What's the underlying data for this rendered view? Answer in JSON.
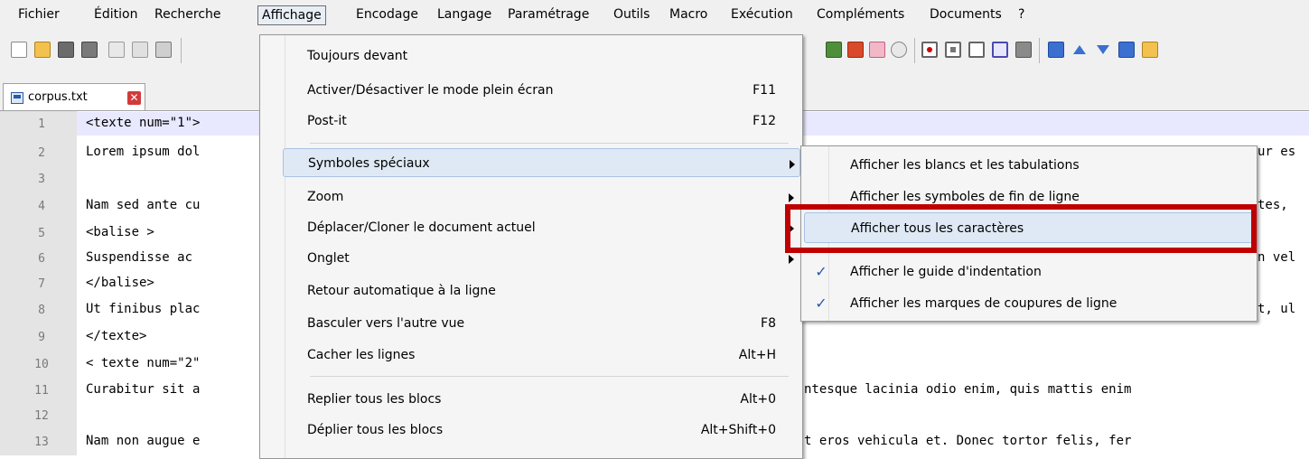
{
  "menubar": {
    "items": [
      "Fichier",
      "Édition",
      "Recherche",
      "Affichage",
      "Encodage",
      "Langage",
      "Paramétrage",
      "Outils",
      "Macro",
      "Exécution",
      "Compléments",
      "Documents",
      "?"
    ],
    "active_index": 3
  },
  "toolbar": {
    "left_icons": [
      "new-file-icon",
      "open-folder-icon",
      "save-icon",
      "save-all-icon",
      "close-icon",
      "close-all-icon",
      "print-icon"
    ],
    "right_icons": [
      "document-map-icon",
      "function-list-icon",
      "folder-workspace-icon",
      "monitoring-icon",
      "record-macro-icon",
      "stop-record-icon",
      "playback-macro-icon",
      "run-macro-multiple-icon",
      "save-macro-icon",
      "sort-icon",
      "arrow-up-icon",
      "arrow-down-icon",
      "sort-descending-icon",
      "folder-icon"
    ]
  },
  "tab": {
    "name": "corpus.txt",
    "close_glyph": "✕"
  },
  "editor": {
    "line_numbers": [
      "1",
      "2",
      "3",
      "4",
      "5",
      "6",
      "7",
      "8",
      "9",
      "10",
      "11",
      "12",
      "13"
    ],
    "lines_left": [
      "<texte num=\"1\">",
      "Lorem ipsum dol",
      "",
      "Nam sed ante cu",
      "<balise >",
      "Suspendisse ac",
      "</balise>",
      "Ut finibus plac",
      "</texte>",
      "< texte num=\"2\"",
      "Curabitur sit a",
      "",
      "Nam non augue e"
    ],
    "lines_right": [
      "",
      "ur es",
      "",
      "tes,",
      "",
      "n vel",
      "",
      "t, ul",
      "",
      "",
      "ntesque lacinia odio enim, quis mattis enim",
      "",
      "t eros vehicula et. Donec tortor felis, fer"
    ]
  },
  "view_menu": {
    "items": [
      {
        "label": "Toujours devant",
        "shortcut": ""
      },
      {
        "label": "Activer/Désactiver le mode plein écran",
        "shortcut": "F11"
      },
      {
        "label": "Post-it",
        "shortcut": "F12"
      },
      {
        "label": "Symboles spéciaux",
        "shortcut": ""
      },
      {
        "label": "Zoom",
        "shortcut": ""
      },
      {
        "label": "Déplacer/Cloner le document actuel",
        "shortcut": ""
      },
      {
        "label": "Onglet",
        "shortcut": ""
      },
      {
        "label": "Retour automatique à la ligne",
        "shortcut": ""
      },
      {
        "label": "Basculer vers l'autre vue",
        "shortcut": "F8"
      },
      {
        "label": "Cacher les lignes",
        "shortcut": "Alt+H"
      },
      {
        "label": "Replier tous les blocs",
        "shortcut": "Alt+0"
      },
      {
        "label": "Déplier tous les blocs",
        "shortcut": "Alt+Shift+0"
      }
    ],
    "highlighted_index": 3
  },
  "special_symbols_submenu": {
    "items": [
      {
        "label": "Afficher les blancs et les tabulations",
        "checked": false
      },
      {
        "label": "Afficher les symboles de fin de ligne",
        "checked": false
      },
      {
        "label": "Afficher tous les caractères",
        "checked": false
      },
      {
        "label": "Afficher le guide d'indentation",
        "checked": true
      },
      {
        "label": "Afficher les marques de coupures de ligne",
        "checked": true
      }
    ],
    "highlighted_index": 2,
    "check_glyph": "✓"
  },
  "colors": {
    "annotation_box": "#c00000",
    "highlight": "#dfe9f5",
    "gutter": "#e4e4e4"
  }
}
